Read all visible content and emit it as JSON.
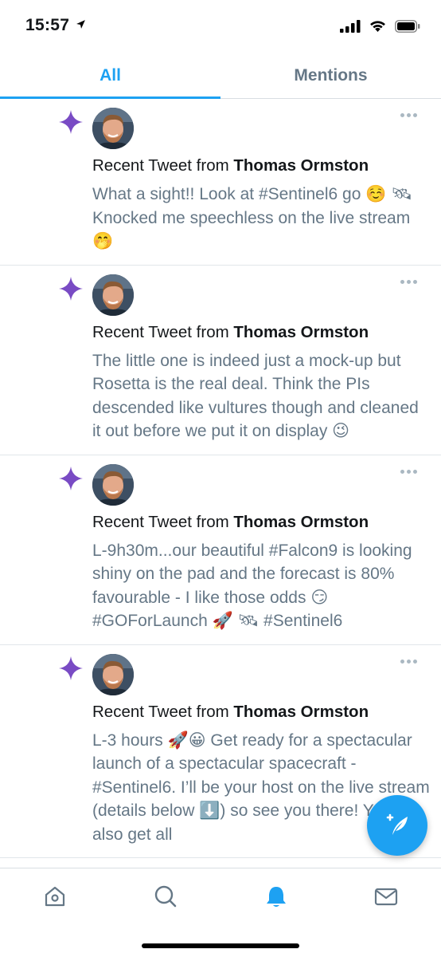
{
  "status": {
    "time": "15:57"
  },
  "tabs": [
    {
      "label": "All",
      "active": true
    },
    {
      "label": "Mentions",
      "active": false
    }
  ],
  "notifications": [
    {
      "prefix": "Recent Tweet from ",
      "author": "Thomas Ormston",
      "text": "What a sight!! Look at #Sentinel6 go ☺️ 🛰 Knocked me speechless on the live stream🤭"
    },
    {
      "prefix": "Recent Tweet from ",
      "author": "Thomas Ormston",
      "text": "The little one is indeed just a mock-up but Rosetta is the real deal. Think the PIs descended like vultures though and cleaned it out before we put it on display 😉"
    },
    {
      "prefix": "Recent Tweet from ",
      "author": "Thomas Ormston",
      "text": "L-9h30m...our beautiful #Falcon9 is looking shiny on the pad and the forecast is 80% favourable - I like those odds 😏 #GOForLaunch 🚀 🛰 #Sentinel6"
    },
    {
      "prefix": "Recent Tweet from ",
      "author": "Thomas Ormston",
      "text": "L-3 hours 🚀😀 Get ready for a spectacular launch of a spectacular spacecraft - #Sentinel6. I’ll be your host on the live stream (details below ⬇️) so see you there! You can also get all"
    }
  ],
  "colors": {
    "accent": "#1da1f2",
    "sparkle": "#794bc4",
    "muted": "#657786"
  },
  "bottom_nav": [
    "home-icon",
    "search-icon",
    "notifications-bell-icon",
    "messages-envelope-icon"
  ]
}
